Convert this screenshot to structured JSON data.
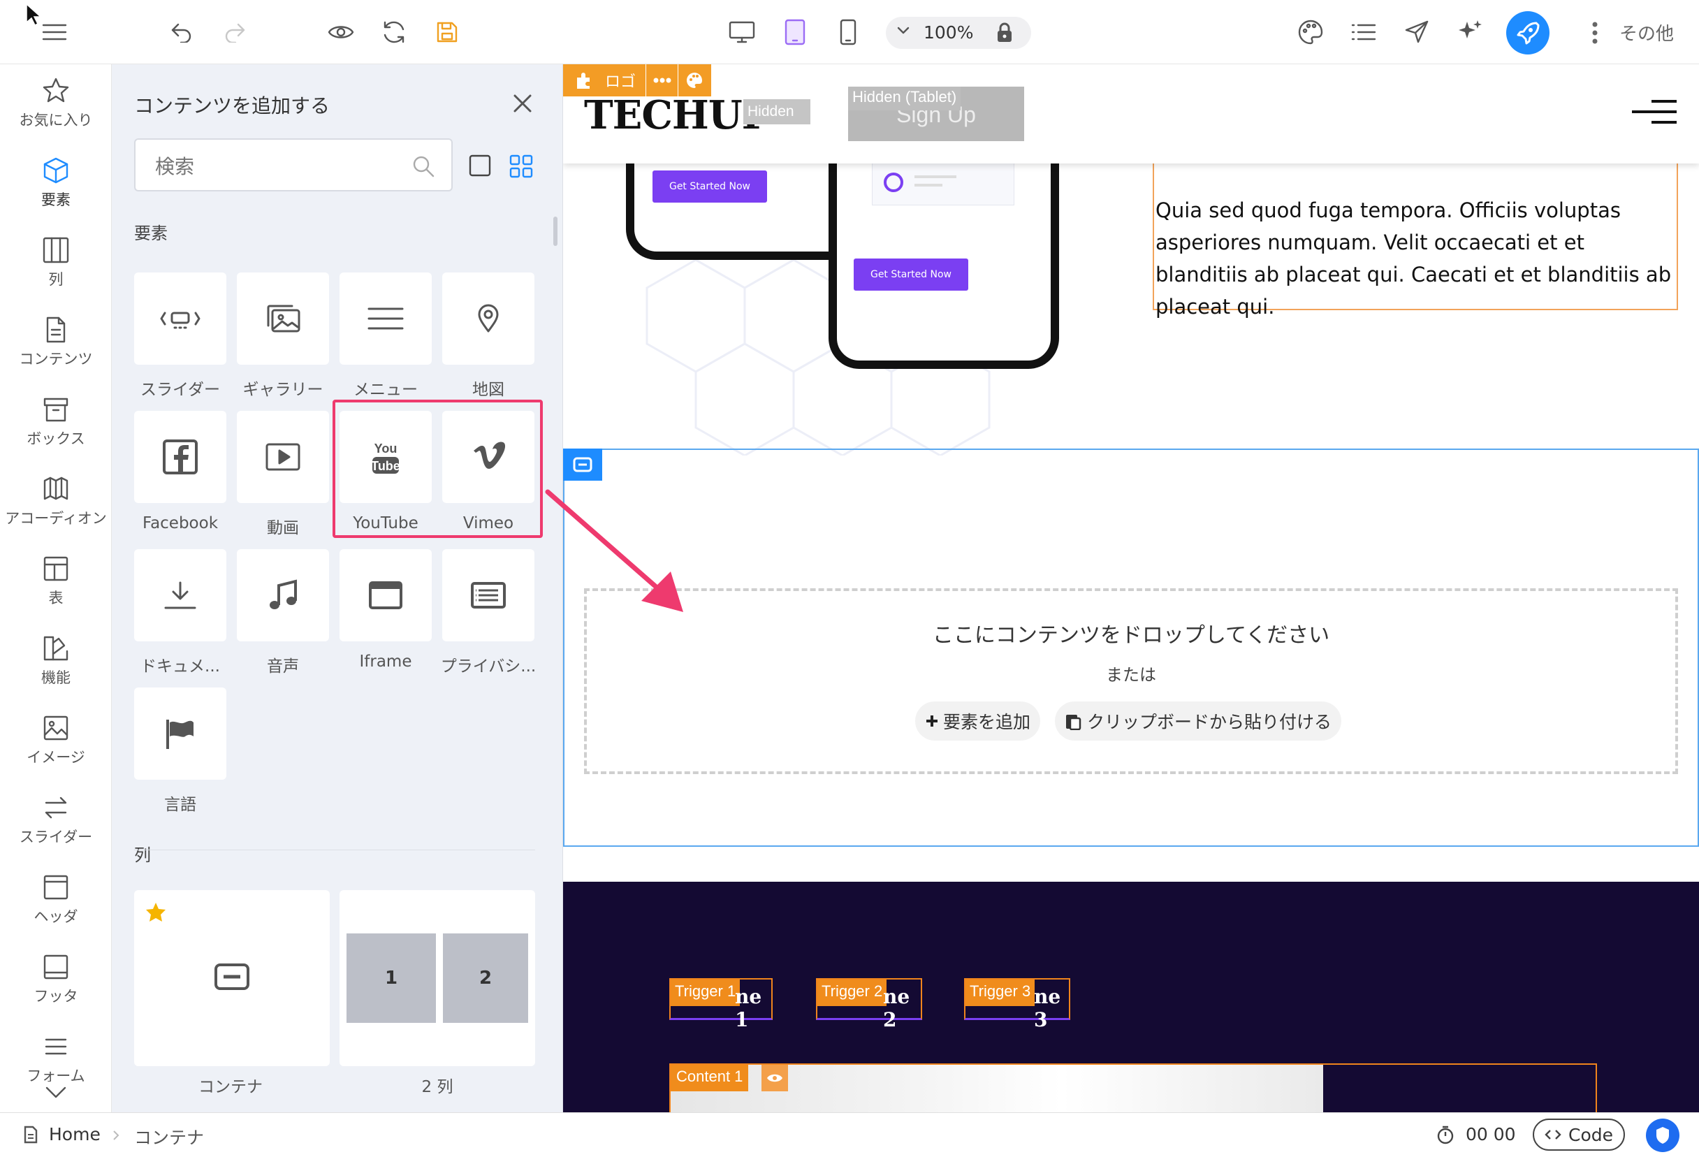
{
  "toolbar": {
    "zoom": "100%",
    "more_label": "その他"
  },
  "rail": {
    "items": [
      {
        "label": "お気に入り"
      },
      {
        "label": "要素"
      },
      {
        "label": "列"
      },
      {
        "label": "コンテンツ"
      },
      {
        "label": "ボックス"
      },
      {
        "label": "アコーディオン"
      },
      {
        "label": "表"
      },
      {
        "label": "機能"
      },
      {
        "label": "イメージ"
      },
      {
        "label": "スライダー"
      },
      {
        "label": "ヘッダ"
      },
      {
        "label": "フッタ"
      },
      {
        "label": "フォーム"
      }
    ]
  },
  "panel": {
    "title": "コンテンツを追加する",
    "search_placeholder": "検索",
    "section_elements": "要素",
    "section_columns": "列",
    "elements": [
      {
        "label": "スライダー",
        "icon": "slider-icon"
      },
      {
        "label": "ギャラリー",
        "icon": "gallery-icon"
      },
      {
        "label": "メニュー",
        "icon": "menu-icon"
      },
      {
        "label": "地図",
        "icon": "map-pin-icon"
      },
      {
        "label": "Facebook",
        "icon": "facebook-icon"
      },
      {
        "label": "動画",
        "icon": "video-icon"
      },
      {
        "label": "YouTube",
        "icon": "youtube-icon"
      },
      {
        "label": "Vimeo",
        "icon": "vimeo-icon"
      },
      {
        "label": "ドキュメ...",
        "icon": "download-icon"
      },
      {
        "label": "音声",
        "icon": "music-icon"
      },
      {
        "label": "Iframe",
        "icon": "iframe-icon"
      },
      {
        "label": "プライバシ...",
        "icon": "privacy-icon"
      },
      {
        "label": "言語",
        "icon": "flag-icon"
      }
    ],
    "columns": [
      {
        "label": "コンテナ"
      },
      {
        "label": "2 列",
        "cells": [
          "1",
          "2"
        ]
      }
    ]
  },
  "canvas": {
    "logo_tag": "ロゴ",
    "brand": "TECHUP",
    "hidden_label": "Hidden",
    "hidden_tablet_label": "Hidden (Tablet)",
    "signup_label": "Sign Up",
    "phone_button_1": "Get Started Now",
    "phone_button_2": "Get Started Now",
    "body_text": "Quia sed quod fuga tempora. Officiis voluptas asperiores numquam. Velit occaecati et et blanditiis ab placeat qui. Caecati et et blanditiis ab placeat qui.",
    "drop_title": "ここにコンテンツをドロップしてください",
    "drop_or": "または",
    "add_element": "要素を追加",
    "paste_clipboard": "クリップボードから貼り付ける",
    "triggers": [
      "Trigger 1",
      "Trigger 2",
      "Trigger 3"
    ],
    "trigger_tails": [
      "ne 1",
      "ne 2",
      "ne 3"
    ],
    "content_tag": "Content 1"
  },
  "bottombar": {
    "home": "Home",
    "breadcrumb": "コンテナ",
    "timer": "00 00",
    "code_label": "Code"
  },
  "colors": {
    "accent_blue": "#1e8cff",
    "highlight_pink": "#ee3a6e",
    "orange_tag": "#f08c1c",
    "dark_section": "#140a33",
    "phone_button": "#7b3ff2"
  }
}
